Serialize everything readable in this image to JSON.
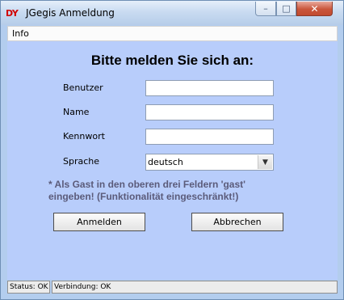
{
  "window": {
    "icon_text": "DY",
    "title": "JGegis Anmeldung",
    "minimize_glyph": "–",
    "maximize_glyph": "□",
    "close_glyph": "✕"
  },
  "menu": {
    "items": [
      {
        "label": "Info"
      }
    ]
  },
  "form": {
    "heading": "Bitte melden Sie sich an:",
    "fields": [
      {
        "label": "Benutzer",
        "value": ""
      },
      {
        "label": "Name",
        "value": ""
      },
      {
        "label": "Kennwort",
        "value": ""
      }
    ],
    "language": {
      "label": "Sprache",
      "selected": "deutsch"
    },
    "hint_line1": "* Als Gast in den oberen drei Feldern 'gast'",
    "hint_line2": "eingeben! (Funktionalität eingeschränkt!)"
  },
  "buttons": {
    "login": "Anmelden",
    "cancel": "Abbrechen"
  },
  "status": {
    "status_text": "Status: OK",
    "connection_text": "Verbindung: OK"
  },
  "icons": {
    "dropdown": "chevron-down-icon",
    "app": "app-logo-icon"
  }
}
